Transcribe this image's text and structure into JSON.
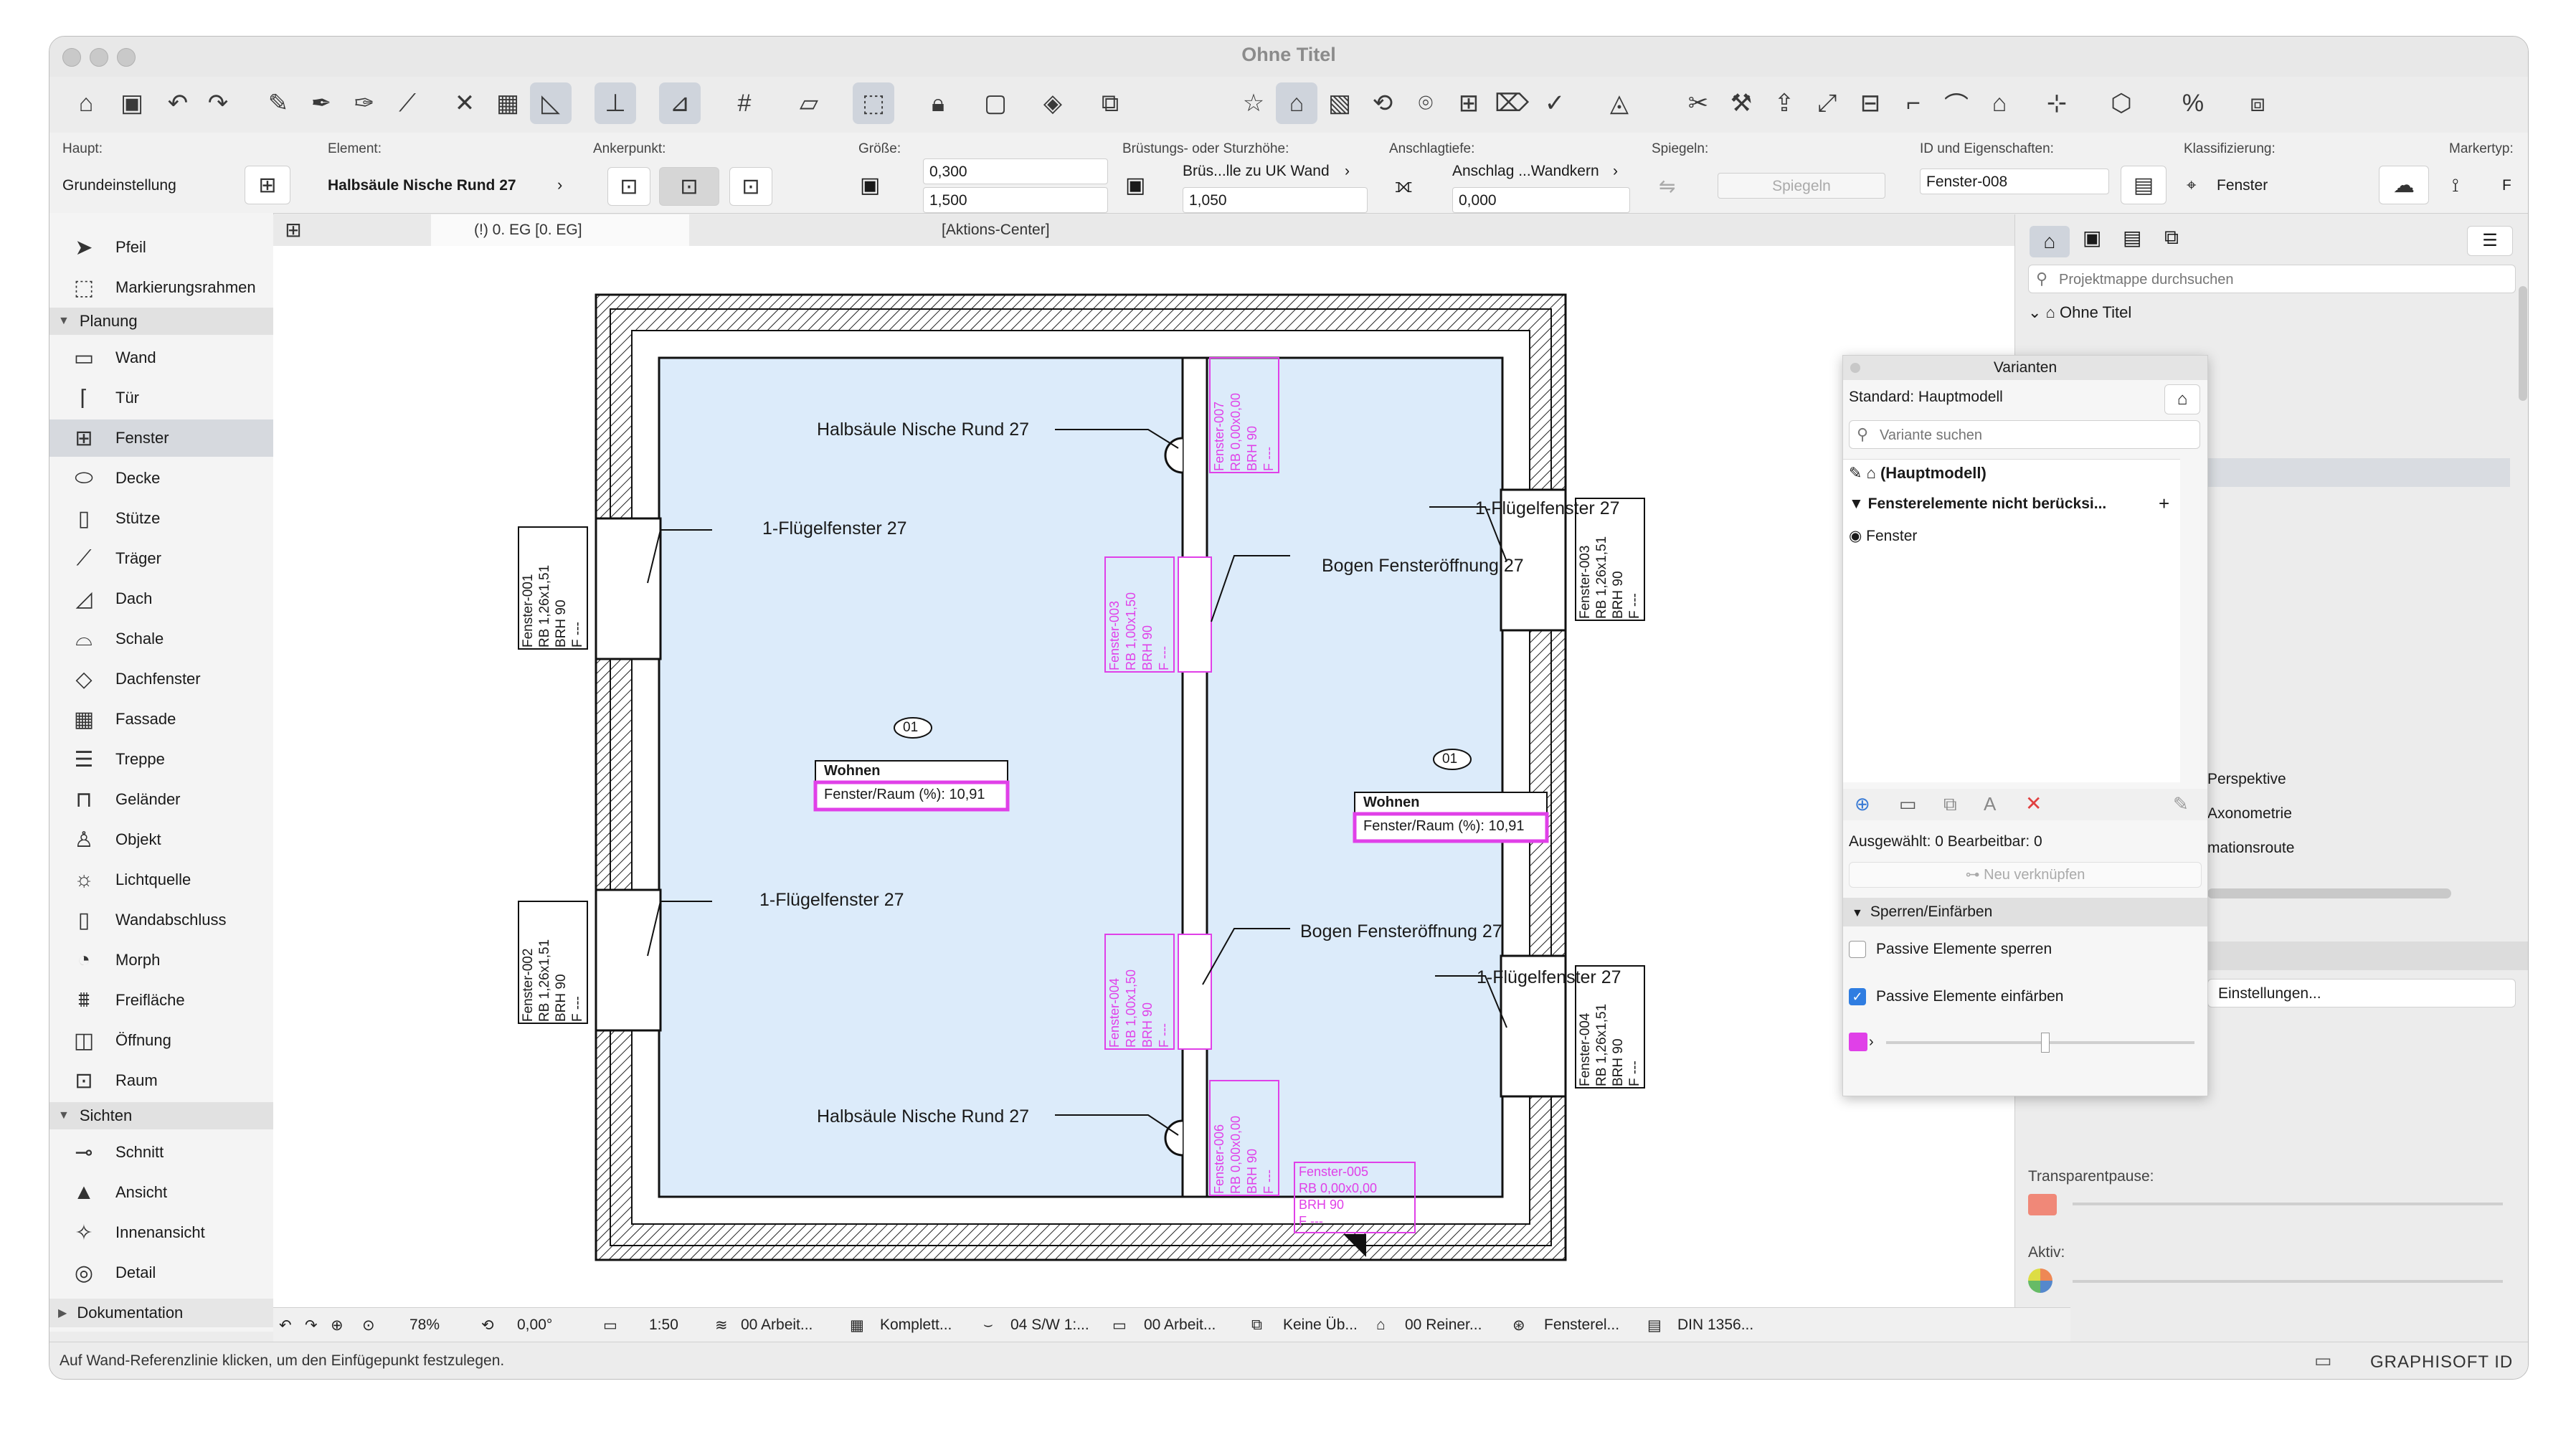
{
  "window": {
    "title": "Ohne Titel"
  },
  "infobox": {
    "haupt_label": "Haupt:",
    "haupt_value": "Grundeinstellung",
    "element_label": "Element:",
    "element_value": "Halbsäule Nische Rund 27",
    "anker_label": "Ankerpunkt:",
    "groesse_label": "Größe:",
    "groesse_w": "0,300",
    "groesse_h": "1,500",
    "bruestung_label": "Brüstungs- oder Sturzhöhe:",
    "bruestung_ref": "Brüs...lle zu UK Wand",
    "bruestung_value": "1,050",
    "anschlag_label": "Anschlagtiefe:",
    "anschlag_ref": "Anschlag ...Wandkern",
    "anschlag_value": "0,000",
    "spiegeln_label": "Spiegeln:",
    "spiegeln_button": "Spiegeln",
    "id_label": "ID und Eigenschaften:",
    "id_value": "Fenster-008",
    "klass_label": "Klassifizierung:",
    "klass_value": "Fenster",
    "marker_label": "Markertyp:",
    "marker_value": "F"
  },
  "toolbox": {
    "top_items": [
      {
        "label": "Pfeil",
        "icon": "arrow-icon"
      },
      {
        "label": "Markierungsrahmen",
        "icon": "marquee-icon"
      }
    ],
    "group_planung": "Planung",
    "planung_items": [
      {
        "label": "Wand",
        "icon": "wall-icon"
      },
      {
        "label": "Tür",
        "icon": "door-icon"
      },
      {
        "label": "Fenster",
        "icon": "window-icon",
        "selected": true
      },
      {
        "label": "Decke",
        "icon": "slab-icon"
      },
      {
        "label": "Stütze",
        "icon": "column-icon"
      },
      {
        "label": "Träger",
        "icon": "beam-icon"
      },
      {
        "label": "Dach",
        "icon": "roof-icon"
      },
      {
        "label": "Schale",
        "icon": "shell-icon"
      },
      {
        "label": "Dachfenster",
        "icon": "skylight-icon"
      },
      {
        "label": "Fassade",
        "icon": "curtain-wall-icon"
      },
      {
        "label": "Treppe",
        "icon": "stair-icon"
      },
      {
        "label": "Geländer",
        "icon": "railing-icon"
      },
      {
        "label": "Objekt",
        "icon": "object-icon"
      },
      {
        "label": "Lichtquelle",
        "icon": "lamp-icon"
      },
      {
        "label": "Wandabschluss",
        "icon": "wall-end-icon"
      },
      {
        "label": "Morph",
        "icon": "morph-icon"
      },
      {
        "label": "Freifläche",
        "icon": "mesh-icon"
      },
      {
        "label": "Öffnung",
        "icon": "opening-icon"
      },
      {
        "label": "Raum",
        "icon": "zone-icon"
      }
    ],
    "group_sichten": "Sichten",
    "sichten_items": [
      {
        "label": "Schnitt",
        "icon": "section-icon"
      },
      {
        "label": "Ansicht",
        "icon": "elevation-icon"
      },
      {
        "label": "Innenansicht",
        "icon": "interior-elevation-icon"
      },
      {
        "label": "Detail",
        "icon": "detail-icon"
      }
    ],
    "group_dokumentation": "Dokumentation"
  },
  "tabs": [
    {
      "label": "(!) 0. EG [0. EG]"
    },
    {
      "label": "[Aktions-Center]"
    }
  ],
  "drawing": {
    "label_halbsaeule_top": "Halbsäule Nische Rund 27",
    "label_halbsaeule_bottom": "Halbsäule Nische Rund 27",
    "label_fluegel_left_top": "1-Flügelfenster 27",
    "label_fluegel_left_bottom": "1-Flügelfenster 27",
    "label_fluegel_right_top": "1-Flügelfenster 27",
    "label_fluegel_right_bottom": "1-Flügelfenster 27",
    "label_bogen_top": "Bogen Fensteröffnung 27",
    "label_bogen_bottom": "Bogen Fensteröffnung 27",
    "zone_left": {
      "number": "01",
      "name": "Wohnen",
      "value": "Fenster/Raum (%): 10,91"
    },
    "zone_right": {
      "number": "01",
      "name": "Wohnen",
      "value": "Fenster/Raum (%): 10,91"
    },
    "tag_001": [
      "Fenster-001",
      "RB 1,26x1,51",
      "BRH 90",
      "F ---"
    ],
    "tag_002": [
      "Fenster-002",
      "RB 1,26x1,51",
      "BRH 90",
      "F ---"
    ],
    "tag_003": [
      "Fenster-003",
      "RB 1,26x1,51",
      "BRH 90",
      "F ---"
    ],
    "tag_004": [
      "Fenster-004",
      "RB 1,26x1,51",
      "BRH 90",
      "F ---"
    ],
    "tag_m003": [
      "Fenster-003",
      "RB 1,00x1,50",
      "BRH 90",
      "F ---"
    ],
    "tag_m004": [
      "Fenster-004",
      "RB 1,00x1,50",
      "BRH 90",
      "F ---"
    ],
    "tag_m006": [
      "Fenster-006",
      "RB 0,00x0,00",
      "BRH 90",
      "F ---"
    ],
    "tag_m007": [
      "Fenster-007",
      "RB 0,00x0,00",
      "BRH 90",
      "F ---"
    ],
    "tag_m005": [
      "Fenster-005",
      "RB 0,00x0,00",
      "BRH 90",
      "F ---"
    ]
  },
  "varianten": {
    "title": "Varianten",
    "standard": "Standard: Hauptmodell",
    "search_placeholder": "Variante suchen",
    "item_main": "(Hauptmodell)",
    "item_group": "Fensterelemente nicht berücksi...",
    "item_fenster": "Fenster",
    "selected_info": "Ausgewählt: 0 Bearbeitbar: 0",
    "link_button": "Neu verknüpfen",
    "section_lock": "Sperren/Einfärben",
    "check_lock": "Passive Elemente sperren",
    "check_color": "Passive Elemente einfärben",
    "color_swatch": "#e040e8"
  },
  "navigator": {
    "search_placeholder": "Projektmappe durchsuchen",
    "root": "Ohne Titel",
    "item_perspektive": "Perspektive",
    "item_axonometrie": "Axonometrie",
    "item_route": "mationsroute",
    "settings": "Einstellungen...",
    "transparent_label": "Transparentpause:",
    "aktiv_label": "Aktiv:"
  },
  "bottombar": {
    "zoom": "78%",
    "angle": "0,00°",
    "scale": "1:50",
    "layer": "00 Arbeit...",
    "model": "Komplett...",
    "pen": "04 S/W 1:...",
    "view": "00 Arbeit...",
    "override": "Keine Üb...",
    "renovation": "00 Reiner...",
    "fensterel": "Fensterel...",
    "din": "DIN 1356..."
  },
  "status": {
    "message": "Auf Wand-Referenzlinie klicken, um den Einfügepunkt festzulegen.",
    "brand": "GRAPHISOFT ID"
  }
}
